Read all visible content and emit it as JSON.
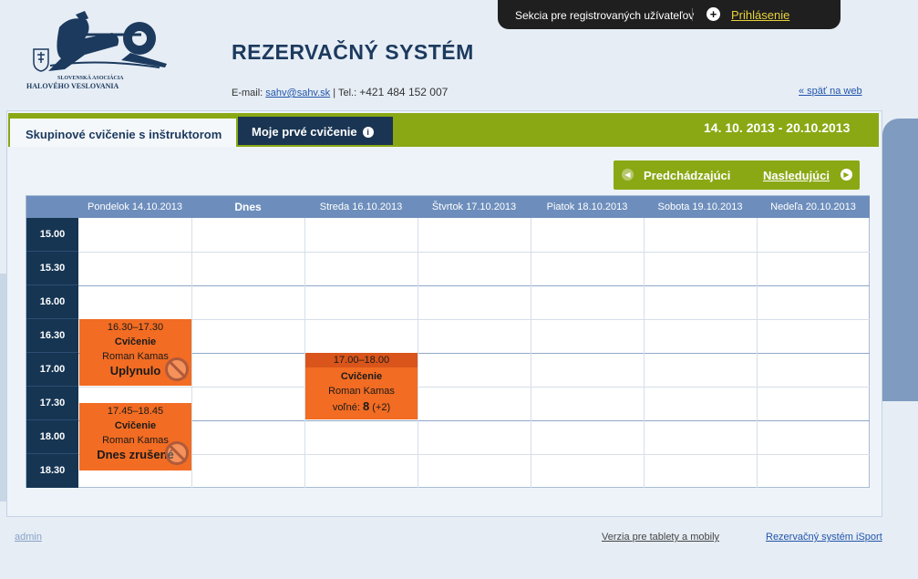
{
  "topbar": {
    "section_label": "Sekcia pre registrovaných užívateľov",
    "login_label": "Prihlásenie"
  },
  "logo": {
    "line1": "SLOVENSKÁ ASOCIÁCIA",
    "line2": "HALOVÉHO VESLOVANIA"
  },
  "header": {
    "title": "REZERVAČNÝ SYSTÉM",
    "email_label": "E-mail:",
    "email": "sahv@sahv.sk",
    "separator": "|",
    "phone_label": "Tel.:",
    "phone": "+421 484 152 007",
    "back_link": "« späť na web"
  },
  "tabs": [
    {
      "label": "Skupinové cvičenie s inštruktorom",
      "active": true
    },
    {
      "label": "Moje prvé cvičenie",
      "active": false
    }
  ],
  "date_range": "14. 10. 2013 - 20.10.2013",
  "nav": {
    "prev_label": "Predchádzajúci",
    "next_label": "Nasledujúci"
  },
  "calendar": {
    "days": [
      "Pondelok  14.10.2013",
      "Dnes",
      "Streda  16.10.2013",
      "Štvrtok  17.10.2013",
      "Piatok  18.10.2013",
      "Sobota  19.10.2013",
      "Nedeľa  20.10.2013"
    ],
    "times": [
      "15.00",
      "15.30",
      "16.00",
      "16.30",
      "17.00",
      "17.30",
      "18.00",
      "18.30"
    ],
    "events": [
      {
        "time": "16.30–17.30",
        "name": "Cvičenie",
        "instructor": "Roman Kamas",
        "status": "Uplynulo"
      },
      {
        "time": "17.45–18.45",
        "name": "Cvičenie",
        "instructor": "Roman Kamas",
        "status": "Dnes zrušené"
      },
      {
        "time": "17.00–18.00",
        "name": "Cvičenie",
        "instructor": "Roman Kamas",
        "free_label": "voľné:",
        "free_count": "8",
        "free_extra": "(+2)"
      }
    ]
  },
  "colors": {
    "accent_green": "#8aa814",
    "navy": "#1a3553",
    "event_orange": "#f26c23",
    "header_blue": "#6d8ebc"
  },
  "footer": {
    "admin": "admin",
    "tablet": "Verzia pre tablety a mobily",
    "isport": "Rezervačný systém iSport"
  }
}
